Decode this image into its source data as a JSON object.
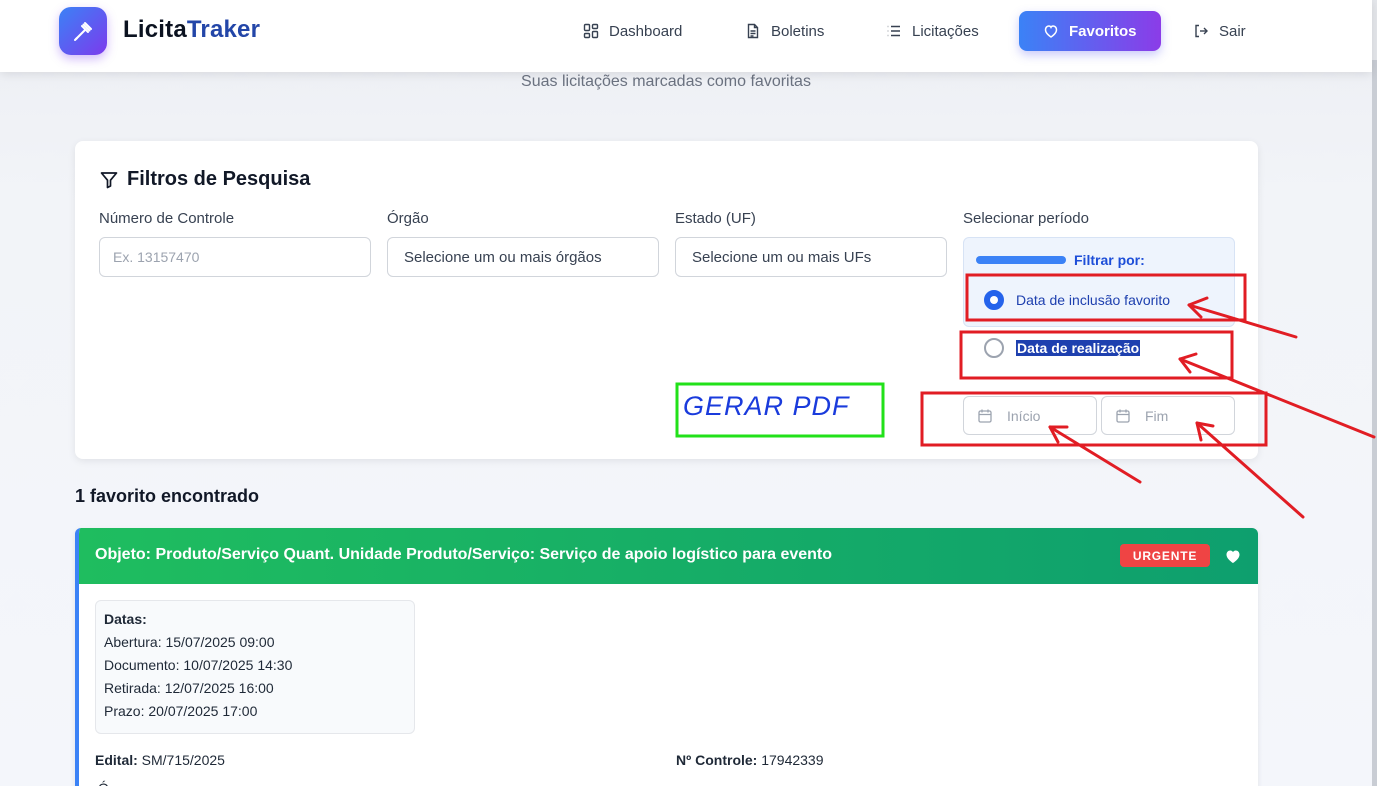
{
  "nav": {
    "brand_main": "Licita",
    "brand_accent": "Traker",
    "items": [
      {
        "label": "Dashboard",
        "icon": "dashboard-icon"
      },
      {
        "label": "Boletins",
        "icon": "document-icon"
      },
      {
        "label": "Licitações",
        "icon": "list-icon"
      },
      {
        "label": "Favoritos",
        "icon": "heart-icon",
        "active": true
      },
      {
        "label": "Sair",
        "icon": "logout-icon"
      }
    ]
  },
  "page": {
    "subtitle": "Suas licitações marcadas como favoritas"
  },
  "filters": {
    "title": "Filtros de Pesquisa",
    "numero_label": "Número de Controle",
    "numero_placeholder": "Ex. 13157470",
    "orgao_label": "Órgão",
    "orgao_value": "Selecione um ou mais órgãos",
    "estado_label": "Estado (UF)",
    "estado_value": "Selecione um ou mais UFs",
    "periodo_label": "Selecionar período",
    "filtrar_por": "Filtrar por:",
    "option_inclusao": "Data de inclusão favorito",
    "option_realizacao": "Data de realização",
    "inicio": "Início",
    "fim": "Fim"
  },
  "results": {
    "count": "1 favorito encontrado",
    "card": {
      "title": "Objeto: Produto/Serviço Quant. Unidade Produto/Serviço: Serviço de apoio logístico para evento",
      "badge": "URGENTE",
      "dates_heading": "Datas:",
      "abertura_label": "Abertura:",
      "abertura": "15/07/2025 09:00",
      "documento_label": "Documento:",
      "documento": "10/07/2025 14:30",
      "retirada_label": "Retirada:",
      "retirada": "12/07/2025 16:00",
      "prazo_label": "Prazo:",
      "prazo": "20/07/2025 17:00",
      "edital_label": "Edital:",
      "edital": "SM/715/2025",
      "controle_label": "Nº Controle:",
      "controle": "17942339",
      "cut_text": "Ó"
    }
  },
  "annotation": {
    "handwritten_note": "GERAR PDF"
  },
  "colors": {
    "accent_blue": "#3b82f6",
    "accent_purple": "#7c3aed",
    "header_green": "#1fbd5f",
    "urgent_red": "#ef4444",
    "annotation_red": "#e11d24",
    "annotation_green": "#22e11a",
    "handwriting_blue": "#1a3bdc"
  }
}
